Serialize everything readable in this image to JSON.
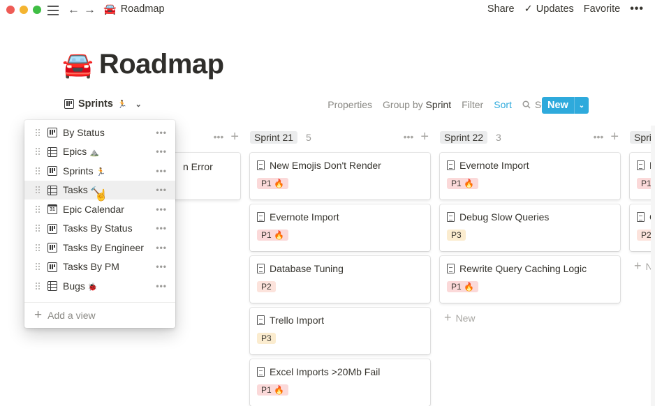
{
  "window": {
    "breadcrumb": {
      "emoji": "🚘",
      "title": "Roadmap"
    },
    "actions": {
      "share": "Share",
      "updates": "Updates",
      "favorite": "Favorite",
      "more": "•••"
    }
  },
  "page": {
    "emoji": "🚘",
    "title": "Roadmap"
  },
  "view_selector": {
    "label": "Sprints",
    "emoji": "🏃",
    "chevron": "⌄"
  },
  "toolbar": {
    "properties": "Properties",
    "group_by_prefix": "Group by",
    "group_by_value": "Sprint",
    "filter": "Filter",
    "sort": "Sort",
    "search": "Search",
    "more": "•••",
    "new_label": "New",
    "accent_color": "#2eaadc"
  },
  "views_menu": {
    "items": [
      {
        "label": "By Status",
        "icon": "board",
        "emoji": ""
      },
      {
        "label": "Epics",
        "icon": "table",
        "emoji": "⛰️"
      },
      {
        "label": "Sprints",
        "icon": "board",
        "emoji": "🏃"
      },
      {
        "label": "Tasks",
        "icon": "table",
        "emoji": "🔨"
      },
      {
        "label": "Epic Calendar",
        "icon": "calendar",
        "emoji": ""
      },
      {
        "label": "Tasks By Status",
        "icon": "board",
        "emoji": ""
      },
      {
        "label": "Tasks By Engineer",
        "icon": "board",
        "emoji": ""
      },
      {
        "label": "Tasks By PM",
        "icon": "board",
        "emoji": ""
      },
      {
        "label": "Bugs",
        "icon": "table",
        "emoji": "🐞"
      }
    ],
    "calendar_glyph": "31",
    "item_more": "•••",
    "add_view": "Add a view"
  },
  "board": {
    "columns": [
      {
        "name": "",
        "count": "",
        "cards": [
          {
            "title": "n Error",
            "tag": ""
          }
        ]
      },
      {
        "name": "Sprint 21",
        "count": "5",
        "cards": [
          {
            "title": "New Emojis Don't Render",
            "tag": "P1 🔥",
            "priority": "p1"
          },
          {
            "title": "Evernote Import",
            "tag": "P1 🔥",
            "priority": "p1"
          },
          {
            "title": "Database Tuning",
            "tag": "P2",
            "priority": "p2"
          },
          {
            "title": "Trello Import",
            "tag": "P3",
            "priority": "p3"
          },
          {
            "title": "Excel Imports >20Mb Fail",
            "tag": "P1 🔥",
            "priority": "p1"
          }
        ]
      },
      {
        "name": "Sprint 22",
        "count": "3",
        "cards": [
          {
            "title": "Evernote Import",
            "tag": "P1 🔥",
            "priority": "p1"
          },
          {
            "title": "Debug Slow Queries",
            "tag": "P3",
            "priority": "p3"
          },
          {
            "title": "Rewrite Query Caching Logic",
            "tag": "P1 🔥",
            "priority": "p1"
          }
        ],
        "add_new": "New"
      },
      {
        "name": "Spri",
        "count": "",
        "cards": [
          {
            "title": "R",
            "tag": "P1",
            "priority": "p1"
          },
          {
            "title": "C",
            "tag": "P2",
            "priority": "p2"
          }
        ],
        "add_new": "N"
      }
    ],
    "col_more": "•••",
    "col_add": "+"
  },
  "tag_colors": {
    "p1": "#fbd9d9",
    "p2": "#fce3dc",
    "p3": "#fbeccf"
  }
}
